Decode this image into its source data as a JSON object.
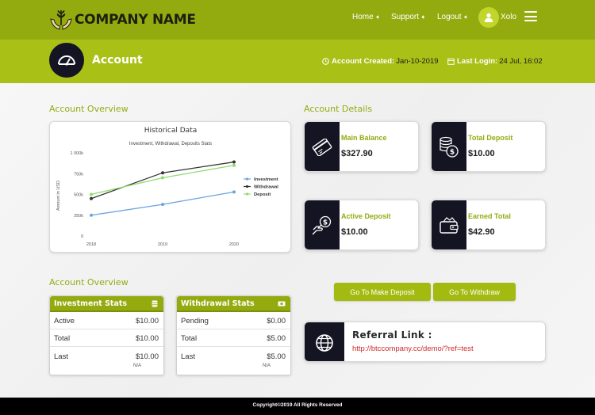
{
  "header": {
    "logo_text": "COMPANY NAME",
    "nav": [
      {
        "label": "Home"
      },
      {
        "label": "Support"
      },
      {
        "label": "Logout"
      }
    ],
    "user_name": "Xolo"
  },
  "subheader": {
    "title": "Account",
    "created_label": "Account Created:",
    "created_value": "Jan-10-2019",
    "last_login_label": "Last Login:",
    "last_login_value": "24 Jul, 16:02"
  },
  "overview": {
    "title": "Account Overview"
  },
  "details": {
    "title": "Account Details",
    "cards": [
      {
        "label": "Main Balance",
        "value": "$327.90",
        "icon": "credit-card-icon"
      },
      {
        "label": "Total Deposit",
        "value": "$10.00",
        "icon": "coin-stack-icon"
      },
      {
        "label": "Active Deposit",
        "value": "$10.00",
        "icon": "hand-money-icon"
      },
      {
        "label": "Earned Total",
        "value": "$42.90",
        "icon": "wallet-icon"
      }
    ]
  },
  "overview2": {
    "title": "Account Overview"
  },
  "investment_stats": {
    "title": "Investment Stats",
    "rows": [
      {
        "label": "Active",
        "value": "$10.00"
      },
      {
        "label": "Total",
        "value": "$10.00"
      },
      {
        "label": "Last",
        "value": "$10.00",
        "sub": "N/A"
      }
    ]
  },
  "withdrawal_stats": {
    "title": "Withdrawal Stats",
    "rows": [
      {
        "label": "Pending",
        "value": "$0.00"
      },
      {
        "label": "Total",
        "value": "$5.00"
      },
      {
        "label": "Last",
        "value": "$5.00",
        "sub": "N/A"
      }
    ]
  },
  "buttons": {
    "deposit": "Go To Make Deposit",
    "withdraw": "Go To Withdraw"
  },
  "referral": {
    "title": "Referral Link :",
    "link": "http://btccompany.cc/demo/?ref=test"
  },
  "footer": {
    "text": "Copyright©2019 All Rights Reserved"
  },
  "colors": {
    "accent": "#94ab10",
    "dark": "#141423"
  },
  "chart_data": {
    "type": "line",
    "title": "Historical Data",
    "subtitle": "Investment, Withdrawal, Deposits Stats",
    "ylabel": "Amount in USD",
    "xlabel": "",
    "categories": [
      "2018",
      "2019",
      "2020"
    ],
    "ytick_labels": [
      "0",
      "250k",
      "500k",
      "750k",
      "1 000k"
    ],
    "ylim": [
      0,
      1000000
    ],
    "legend_position": "right",
    "grid": false,
    "series": [
      {
        "name": "Investment",
        "values": [
          250000,
          380000,
          530000
        ],
        "color": "#6aa3e0"
      },
      {
        "name": "Withdrawal",
        "values": [
          450000,
          760000,
          890000
        ],
        "color": "#333333"
      },
      {
        "name": "Deposit",
        "values": [
          500000,
          700000,
          850000
        ],
        "color": "#8edc6e"
      }
    ]
  }
}
